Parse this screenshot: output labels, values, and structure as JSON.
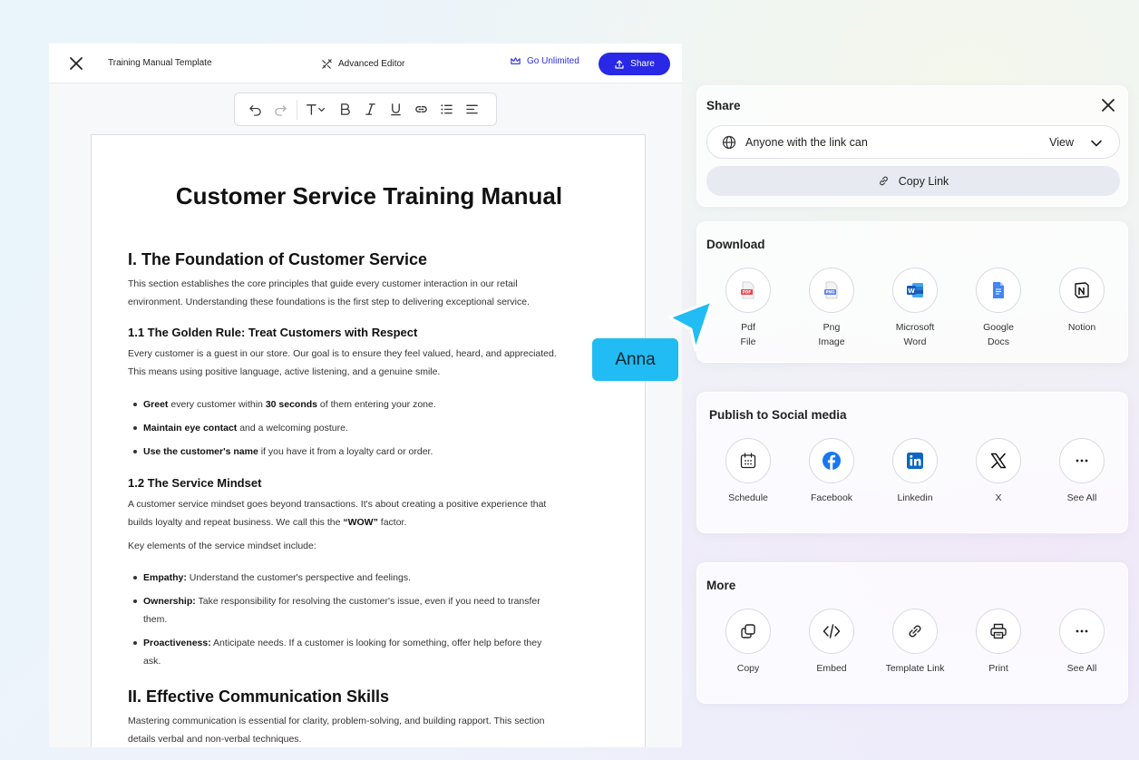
{
  "topbar": {
    "title": "Training Manual Template",
    "advanced_editor": "Advanced Editor",
    "go_unlimited": "Go Unlimited",
    "share": "Share"
  },
  "document": {
    "title": "Customer Service Training Manual",
    "s1_heading": "I. The Foundation of Customer Service",
    "s1_intro_line1": "This section establishes the core principles that guide every customer interaction in our retail",
    "s1_intro_line2": "environment. Understanding these foundations is the first step to delivering exceptional service.",
    "s11_heading": "1.1 The Golden Rule: Treat Customers with Respect",
    "s11_text_line1": "Every customer is a guest in our store. Our goal is to ensure they feel valued, heard, and appreciated.",
    "s11_text_line2": "This means using positive language, active listening, and a genuine smile.",
    "b1_bold": "Greet",
    "b1_a": " every customer within ",
    "b1_bold2": "30 seconds",
    "b1_b": " of them entering your zone.",
    "b2_bold": "Maintain eye contact",
    "b2_rest": " and a welcoming posture.",
    "b3_bold": "Use the customer's name",
    "b3_rest": " if you have it from a loyalty card or order.",
    "s12_heading": "1.2 The Service Mindset",
    "s12_text_line1": "A customer service mindset goes beyond transactions. It's about creating a positive experience that",
    "s12_text_line2a": "builds loyalty and repeat business. We call this the ",
    "s12_text_bold": "“WOW”",
    "s12_text_line2b": " factor.",
    "s12_key": "Key elements of the service mindset include:",
    "k1_bold": "Empathy:",
    "k1_rest": " Understand the customer's perspective and feelings.",
    "k2_bold": "Ownership:",
    "k2_rest_line1": " Take responsibility for resolving the customer's issue, even if you need to transfer",
    "k2_rest_line2": "them.",
    "k3_bold": "Proactiveness:",
    "k3_rest_line1": " Anticipate needs. If a customer is looking for something, offer help before they",
    "k3_rest_line2": "ask.",
    "s2_heading": "II. Effective Communication Skills",
    "s2_text_line1": "Mastering communication is essential for clarity, problem-solving, and building rapport. This section",
    "s2_text_line2": "details verbal and non-verbal techniques."
  },
  "share_panel": {
    "title": "Share",
    "link_access": "Anyone with the link can",
    "permission": "View",
    "copy_link": "Copy Link"
  },
  "download_panel": {
    "title": "Download",
    "items": [
      {
        "line1": "Pdf",
        "line2": "File",
        "icon": "pdf-icon"
      },
      {
        "line1": "Png",
        "line2": "Image",
        "icon": "png-icon"
      },
      {
        "line1": "Microsoft",
        "line2": "Word",
        "icon": "word-icon"
      },
      {
        "line1": "Google",
        "line2": "Docs",
        "icon": "google-docs-icon"
      },
      {
        "line1": "Notion",
        "line2": "",
        "icon": "notion-icon"
      }
    ]
  },
  "social_panel": {
    "title": "Publish to Social media",
    "items": [
      {
        "label": "Schedule",
        "icon": "calendar-icon"
      },
      {
        "label": "Facebook",
        "icon": "facebook-icon"
      },
      {
        "label": "Linkedin",
        "icon": "linkedin-icon"
      },
      {
        "label": "X",
        "icon": "x-icon"
      },
      {
        "label": "See All",
        "icon": "more-icon"
      }
    ]
  },
  "more_panel": {
    "title": "More",
    "items": [
      {
        "label": "Copy",
        "icon": "copy-icon"
      },
      {
        "label": "Embed",
        "icon": "code-icon"
      },
      {
        "label": "Template Link",
        "icon": "link-icon"
      },
      {
        "label": "Print",
        "icon": "printer-icon"
      },
      {
        "label": "See All",
        "icon": "more-icon"
      }
    ]
  },
  "collaborator": {
    "name": "Anna"
  },
  "colors": {
    "accent": "#2828e6",
    "cursor": "#21bcf3",
    "facebook": "#1877f2",
    "linkedin": "#0a66c2",
    "word": "#185abd",
    "google_docs": "#4285f4",
    "pdf": "#e5484d"
  }
}
